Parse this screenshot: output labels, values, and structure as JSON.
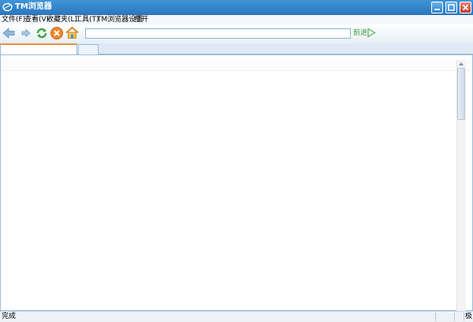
{
  "window": {
    "title": "TM浏览器",
    "minimize_icon": "minimize-icon",
    "maximize_icon": "maximize-icon",
    "close_icon": "close-icon"
  },
  "menu": {
    "items": [
      {
        "label": "文件(F)"
      },
      {
        "label": "查看(V)"
      },
      {
        "label": "收藏夹(L)"
      },
      {
        "label": "工具(T)"
      },
      {
        "label": "TM浏览器设置"
      },
      {
        "label": "打开"
      }
    ]
  },
  "toolbar": {
    "icons": [
      "back-icon",
      "forward-icon",
      "refresh-icon",
      "stop-icon",
      "home-icon"
    ],
    "address_value": "",
    "go_label": "前进",
    "go_icon": "play-arrow-icon"
  },
  "tabs": [
    {
      "label": ""
    },
    {
      "label": ""
    }
  ],
  "status": {
    "text": "完成",
    "right_text": "极"
  },
  "colors": {
    "titlebar": "#2b79c2",
    "tab_accent": "#f08a3c",
    "go_green": "#3a9a3a"
  }
}
